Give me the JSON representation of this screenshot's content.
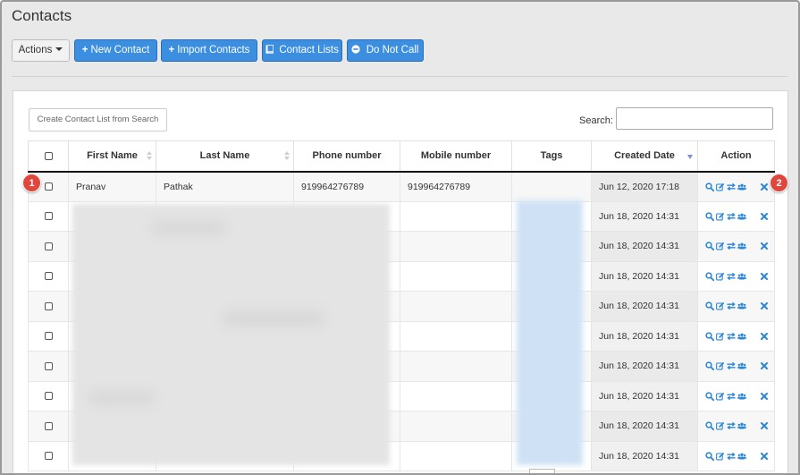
{
  "header": {
    "title": "Contacts"
  },
  "toolbar": {
    "actions_label": "Actions",
    "new_contact_label": "New Contact",
    "import_contacts_label": "Import Contacts",
    "contact_lists_label": "Contact Lists",
    "do_not_call_label": "Do Not Call"
  },
  "panel": {
    "create_list_label": "Create Contact List from Search",
    "search_label": "Search:",
    "search_value": ""
  },
  "table": {
    "columns": [
      "First Name",
      "Last Name",
      "Phone number",
      "Mobile number",
      "Tags",
      "Created Date",
      "Action"
    ],
    "rows": [
      {
        "first": "Pranav",
        "last": "Pathak",
        "phone": "919964276789",
        "mobile": "919964276789",
        "tags": "",
        "created": "Jun 12, 2020 17:18"
      },
      {
        "first": "",
        "last": "",
        "phone": "",
        "mobile": "",
        "tags": "",
        "created": "Jun 18, 2020 14:31"
      },
      {
        "first": "",
        "last": "",
        "phone": "",
        "mobile": "",
        "tags": "",
        "created": "Jun 18, 2020 14:31"
      },
      {
        "first": "",
        "last": "",
        "phone": "",
        "mobile": "",
        "tags": "",
        "created": "Jun 18, 2020 14:31"
      },
      {
        "first": "",
        "last": "",
        "phone": "",
        "mobile": "",
        "tags": "",
        "created": "Jun 18, 2020 14:31"
      },
      {
        "first": "",
        "last": "",
        "phone": "",
        "mobile": "",
        "tags": "",
        "created": "Jun 18, 2020 14:31"
      },
      {
        "first": "",
        "last": "",
        "phone": "",
        "mobile": "",
        "tags": "",
        "created": "Jun 18, 2020 14:31"
      },
      {
        "first": "",
        "last": "",
        "phone": "",
        "mobile": "",
        "tags": "",
        "created": "Jun 18, 2020 14:31"
      },
      {
        "first": "",
        "last": "",
        "phone": "",
        "mobile": "",
        "tags": "",
        "created": "Jun 18, 2020 14:31"
      },
      {
        "first": "",
        "last": "",
        "phone": "",
        "mobile": "",
        "tags": "",
        "created": "Jun 18, 2020 14:31"
      }
    ],
    "action_icons": [
      "search-icon",
      "edit-icon",
      "transfer-icon",
      "group-icon",
      "close-icon"
    ]
  },
  "annotations": [
    {
      "label": "1"
    },
    {
      "label": "2"
    }
  ],
  "colors": {
    "primary": "#3b8ee0",
    "action_icon": "#2a86d6",
    "badge": "#e0463b",
    "page_bg": "#e9e9e9"
  }
}
